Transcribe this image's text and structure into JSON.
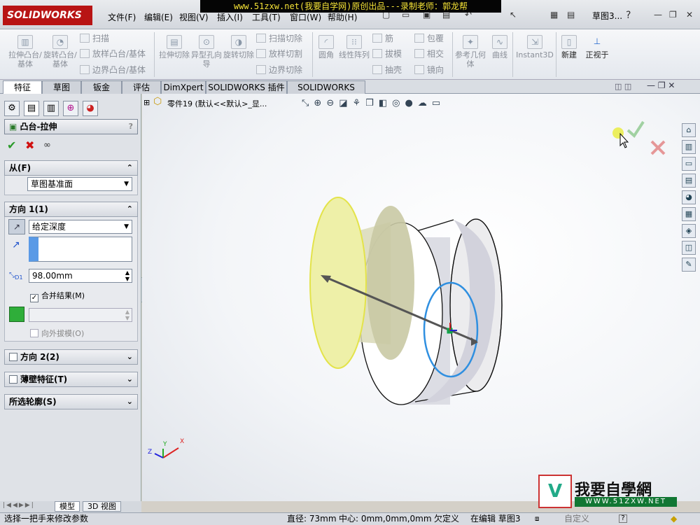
{
  "app": {
    "logo_text": "SOLIDWORKS",
    "doc_title": "草图3..."
  },
  "banner": "www.51zxw.net(我要自学网)原创出品---录制老师：郭龙帮",
  "menu": [
    "文件(F)",
    "编辑(E)",
    "视图(V)",
    "插入(I)",
    "工具(T)",
    "窗口(W)",
    "帮助(H)"
  ],
  "ribbon": {
    "extrude_boss": "拉伸凸台/基体",
    "revolve_boss": "旋转凸台/基体",
    "sweep": "扫描",
    "loft": "放样凸台/基体",
    "boundary_boss": "边界凸台/基体",
    "extrude_cut": "拉伸切除",
    "hole_wizard": "异型孔向导",
    "revolve_cut": "旋转切除",
    "swept_cut": "扫描切除",
    "lofted_cut": "放样切割",
    "boundary_cut": "边界切除",
    "fillet": "圆角",
    "linear_pattern": "线性阵列",
    "rib": "筋",
    "draft": "拔模",
    "shell": "抽壳",
    "wrap": "包覆",
    "intersect": "相交",
    "mirror": "镜向",
    "ref_geometry": "参考几何体",
    "curves": "曲线",
    "instant3d": "Instant3D",
    "new": "新建",
    "normal_to": "正视于"
  },
  "tabs": [
    "特征",
    "草图",
    "钣金",
    "评估",
    "DimXpert",
    "SOLIDWORKS 插件",
    "SOLIDWORKS MBD"
  ],
  "property_manager": {
    "title": "凸台-拉伸",
    "help": "?",
    "from_label": "从(F)",
    "from_value": "草图基准面",
    "dir1_label": "方向 1(1)",
    "end_condition": "给定深度",
    "depth": "98.00mm",
    "depth_tag": "D1",
    "merge_label": "合并结果(M)",
    "merge_checked": true,
    "draft_outward": "向外拔模(O)",
    "dir2_label": "方向 2(2)",
    "thin_label": "薄壁特征(T)",
    "contours_label": "所选轮廓(S)"
  },
  "tree": {
    "part": "零件19  (默认<<默认>_显..."
  },
  "bottom_tabs": [
    "模型",
    "3D 视图"
  ],
  "status": {
    "hint": "选择一把手来修改参数",
    "diameter": "直径: 73mm",
    "center": "中心: 0mm,0mm,0mm",
    "defined": "欠定义",
    "editing": "在编辑 草图3",
    "custom": "自定义"
  },
  "watermark": {
    "text": "我要自學網",
    "url": "WWW.51ZXW.NET"
  },
  "triad": {
    "x": "X",
    "y": "Y",
    "z": "Z"
  },
  "colors": {
    "accent": "#b81414",
    "banner_text": "#f4e236",
    "preview_face": "#eef0a8",
    "sketch_circle": "#2f8fe0"
  }
}
